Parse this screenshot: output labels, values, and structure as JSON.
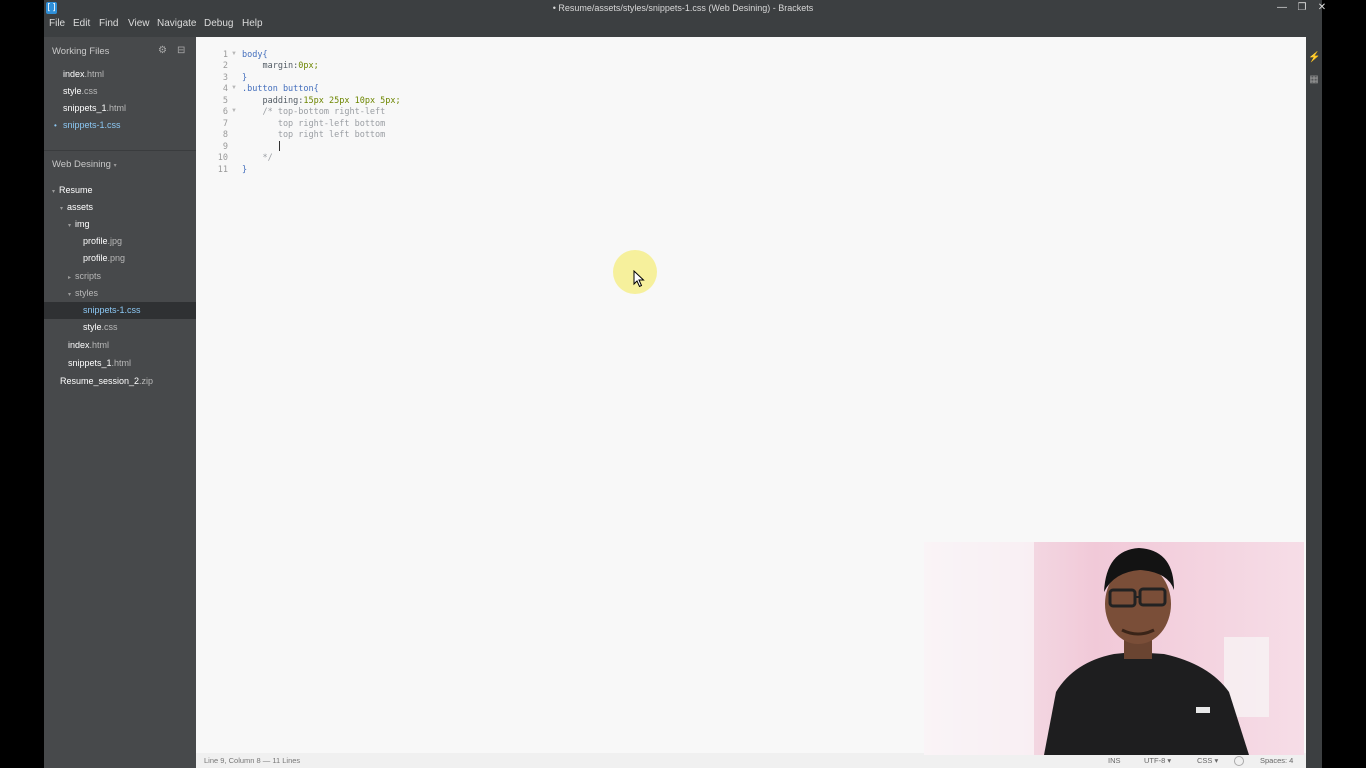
{
  "window": {
    "title": "• Resume/assets/styles/snippets-1.css (Web Desining) - Brackets",
    "app_icon": "brackets-icon",
    "controls": {
      "minimize": "—",
      "restore": "❐",
      "close": "✕"
    }
  },
  "menu": [
    "File",
    "Edit",
    "Find",
    "View",
    "Navigate",
    "Debug",
    "Help"
  ],
  "sidebar": {
    "working_files_title": "Working Files",
    "working_files": [
      {
        "name": "index",
        "ext": ".html"
      },
      {
        "name": "style",
        "ext": ".css"
      },
      {
        "name": "snippets_1",
        "ext": ".html"
      },
      {
        "name": "snippets-1",
        "ext": ".css",
        "modified": true,
        "active": true
      }
    ],
    "project_title": "Web Desining",
    "tree": [
      {
        "name": "Resume",
        "ext": "",
        "folder": true
      },
      {
        "name": "assets",
        "ext": "",
        "folder": true
      },
      {
        "name": "img",
        "ext": "",
        "folder": true
      },
      {
        "name": "profile",
        "ext": ".jpg"
      },
      {
        "name": "profile",
        "ext": ".png"
      },
      {
        "name": "scripts",
        "ext": "",
        "folder": true
      },
      {
        "name": "styles",
        "ext": "",
        "folder": true
      },
      {
        "name": "snippets-1",
        "ext": ".css",
        "selected": true
      },
      {
        "name": "style",
        "ext": ".css"
      },
      {
        "name": "index",
        "ext": ".html"
      },
      {
        "name": "snippets_1",
        "ext": ".html"
      },
      {
        "name": "Resume_session_2",
        "ext": ".zip"
      }
    ]
  },
  "editor": {
    "line_numbers": [
      "1",
      "2",
      "3",
      "4",
      "5",
      "6",
      "7",
      "8",
      "9",
      "10",
      "11"
    ],
    "lines": {
      "l1": "body{",
      "l2_prop": "    margin:",
      "l2_val": "0px;",
      "l3": "}",
      "l4": ".button button{",
      "l5_prop": "    padding:",
      "l5_val": "15px 25px 10px 5px;",
      "l6": "    /* top-bottom right-left",
      "l7": "       top right-left bottom",
      "l8": "       top right left bottom",
      "l9": "",
      "l10": "    */",
      "l11": "}"
    }
  },
  "status": {
    "position": "Line 9, Column 8 — 11 Lines",
    "ins": "INS",
    "encoding": "UTF-8 ▾",
    "language": "CSS ▾",
    "spaces": "Spaces: 4"
  },
  "colors": {
    "chrome": "#3c3f41",
    "sidebar": "#47494b",
    "editor_bg": "#f8f8f8",
    "selector": "#446fbd",
    "value": "#6d8600",
    "comment": "#9a9ea3",
    "active_file": "#8cc8f4"
  }
}
